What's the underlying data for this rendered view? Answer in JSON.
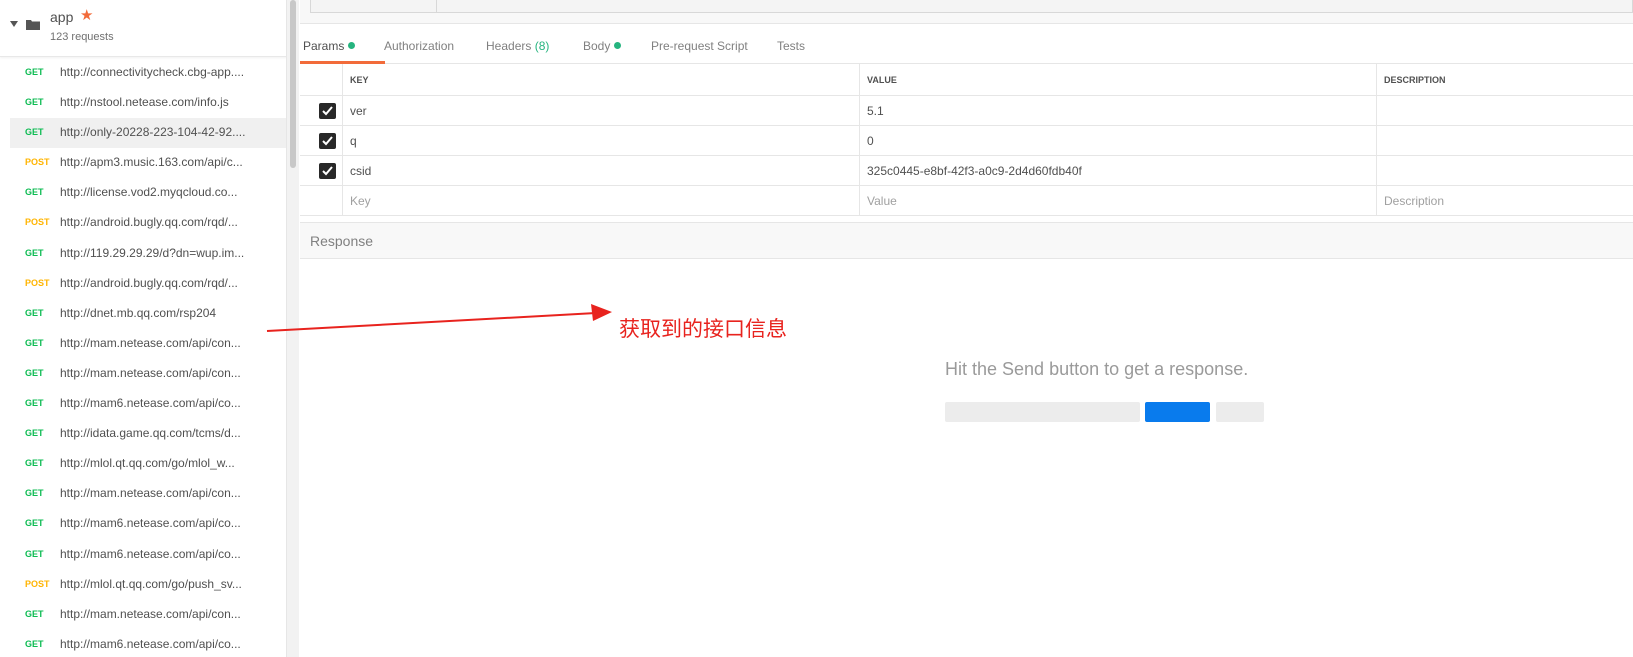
{
  "collection": {
    "name": "app",
    "count_label": "123 requests"
  },
  "requests": [
    {
      "method": "GET",
      "url": "http://connectivitycheck.cbg-app...."
    },
    {
      "method": "GET",
      "url": "http://nstool.netease.com/info.js"
    },
    {
      "method": "GET",
      "url": "http://only-20228-223-104-42-92....",
      "active": true
    },
    {
      "method": "POST",
      "url": "http://apm3.music.163.com/api/c..."
    },
    {
      "method": "GET",
      "url": "http://license.vod2.myqcloud.co..."
    },
    {
      "method": "POST",
      "url": "http://android.bugly.qq.com/rqd/..."
    },
    {
      "method": "GET",
      "url": "http://119.29.29.29/d?dn=wup.im..."
    },
    {
      "method": "POST",
      "url": "http://android.bugly.qq.com/rqd/..."
    },
    {
      "method": "GET",
      "url": "http://dnet.mb.qq.com/rsp204"
    },
    {
      "method": "GET",
      "url": "http://mam.netease.com/api/con..."
    },
    {
      "method": "GET",
      "url": "http://mam.netease.com/api/con..."
    },
    {
      "method": "GET",
      "url": "http://mam6.netease.com/api/co..."
    },
    {
      "method": "GET",
      "url": "http://idata.game.qq.com/tcms/d..."
    },
    {
      "method": "GET",
      "url": "http://mlol.qt.qq.com/go/mlol_w..."
    },
    {
      "method": "GET",
      "url": "http://mam.netease.com/api/con..."
    },
    {
      "method": "GET",
      "url": "http://mam6.netease.com/api/co..."
    },
    {
      "method": "GET",
      "url": "http://mam6.netease.com/api/co..."
    },
    {
      "method": "POST",
      "url": "http://mlol.qt.qq.com/go/push_sv..."
    },
    {
      "method": "GET",
      "url": "http://mam.netease.com/api/con..."
    },
    {
      "method": "GET",
      "url": "http://mam6.netease.com/api/co..."
    }
  ],
  "tabs": {
    "params": "Params",
    "authorization": "Authorization",
    "headers": "Headers",
    "headers_count": "(8)",
    "body": "Body",
    "prerequest": "Pre-request Script",
    "tests": "Tests"
  },
  "params": {
    "headers": {
      "key": "KEY",
      "value": "VALUE",
      "description": "DESCRIPTION"
    },
    "rows": [
      {
        "key": "ver",
        "value": "5.1",
        "checked": true
      },
      {
        "key": "q",
        "value": "0",
        "checked": true
      },
      {
        "key": "csid",
        "value": "325c0445-e8bf-42f3-a0c9-2d4d60fdb40f",
        "checked": true
      }
    ],
    "placeholders": {
      "key": "Key",
      "value": "Value",
      "description": "Description"
    }
  },
  "response": {
    "label": "Response",
    "hint": "Hit the Send button to get a response."
  },
  "annotation": {
    "text": "获取到的接口信息"
  },
  "colors": {
    "accent": "#f26b3a",
    "get": "#0cbb52",
    "post": "#ffb400",
    "send": "#097bed",
    "annotation": "#e8231e"
  }
}
